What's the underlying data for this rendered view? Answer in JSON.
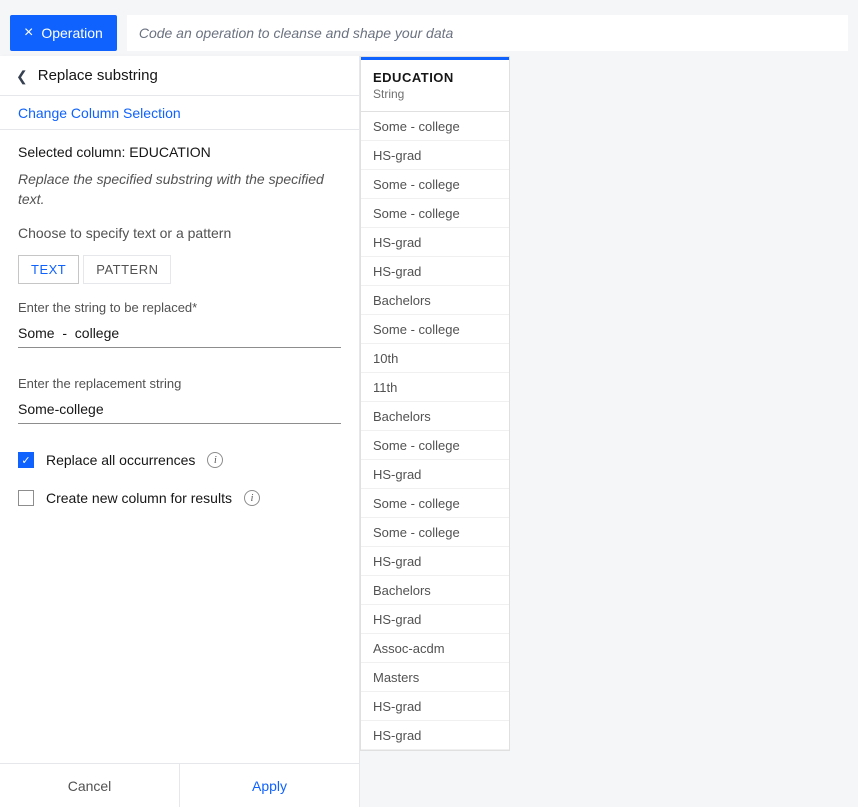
{
  "topbar": {
    "operation_label": "Operation",
    "code_placeholder": "Code an operation to cleanse and shape your data"
  },
  "panel": {
    "title": "Replace substring",
    "change_selection": "Change Column Selection",
    "selected_col_prefix": "Selected column: ",
    "selected_col_name": "EDUCATION",
    "description": "Replace the specified substring with the specified text.",
    "choose": "Choose to specify text or a pattern",
    "tabs": {
      "text": "TEXT",
      "pattern": "PATTERN"
    },
    "field_replace_label": "Enter the string to be replaced*",
    "field_replace_value": "Some  -  college",
    "field_replacement_label": "Enter the replacement string",
    "field_replacement_value": "Some-college",
    "check_replace_all": "Replace all occurrences",
    "check_new_column": "Create new column for results"
  },
  "footer": {
    "cancel": "Cancel",
    "apply": "Apply"
  },
  "column": {
    "name": "EDUCATION",
    "type": "String",
    "rows": [
      "Some  -  college",
      "HS-grad",
      "Some  -  college",
      "Some  -  college",
      "HS-grad",
      "HS-grad",
      "Bachelors",
      "Some  -  college",
      "10th",
      "11th",
      "Bachelors",
      "Some  -  college",
      "HS-grad",
      "Some  -  college",
      "Some  -  college",
      "HS-grad",
      "Bachelors",
      "HS-grad",
      "Assoc-acdm",
      "Masters",
      "HS-grad",
      "HS-grad"
    ]
  }
}
